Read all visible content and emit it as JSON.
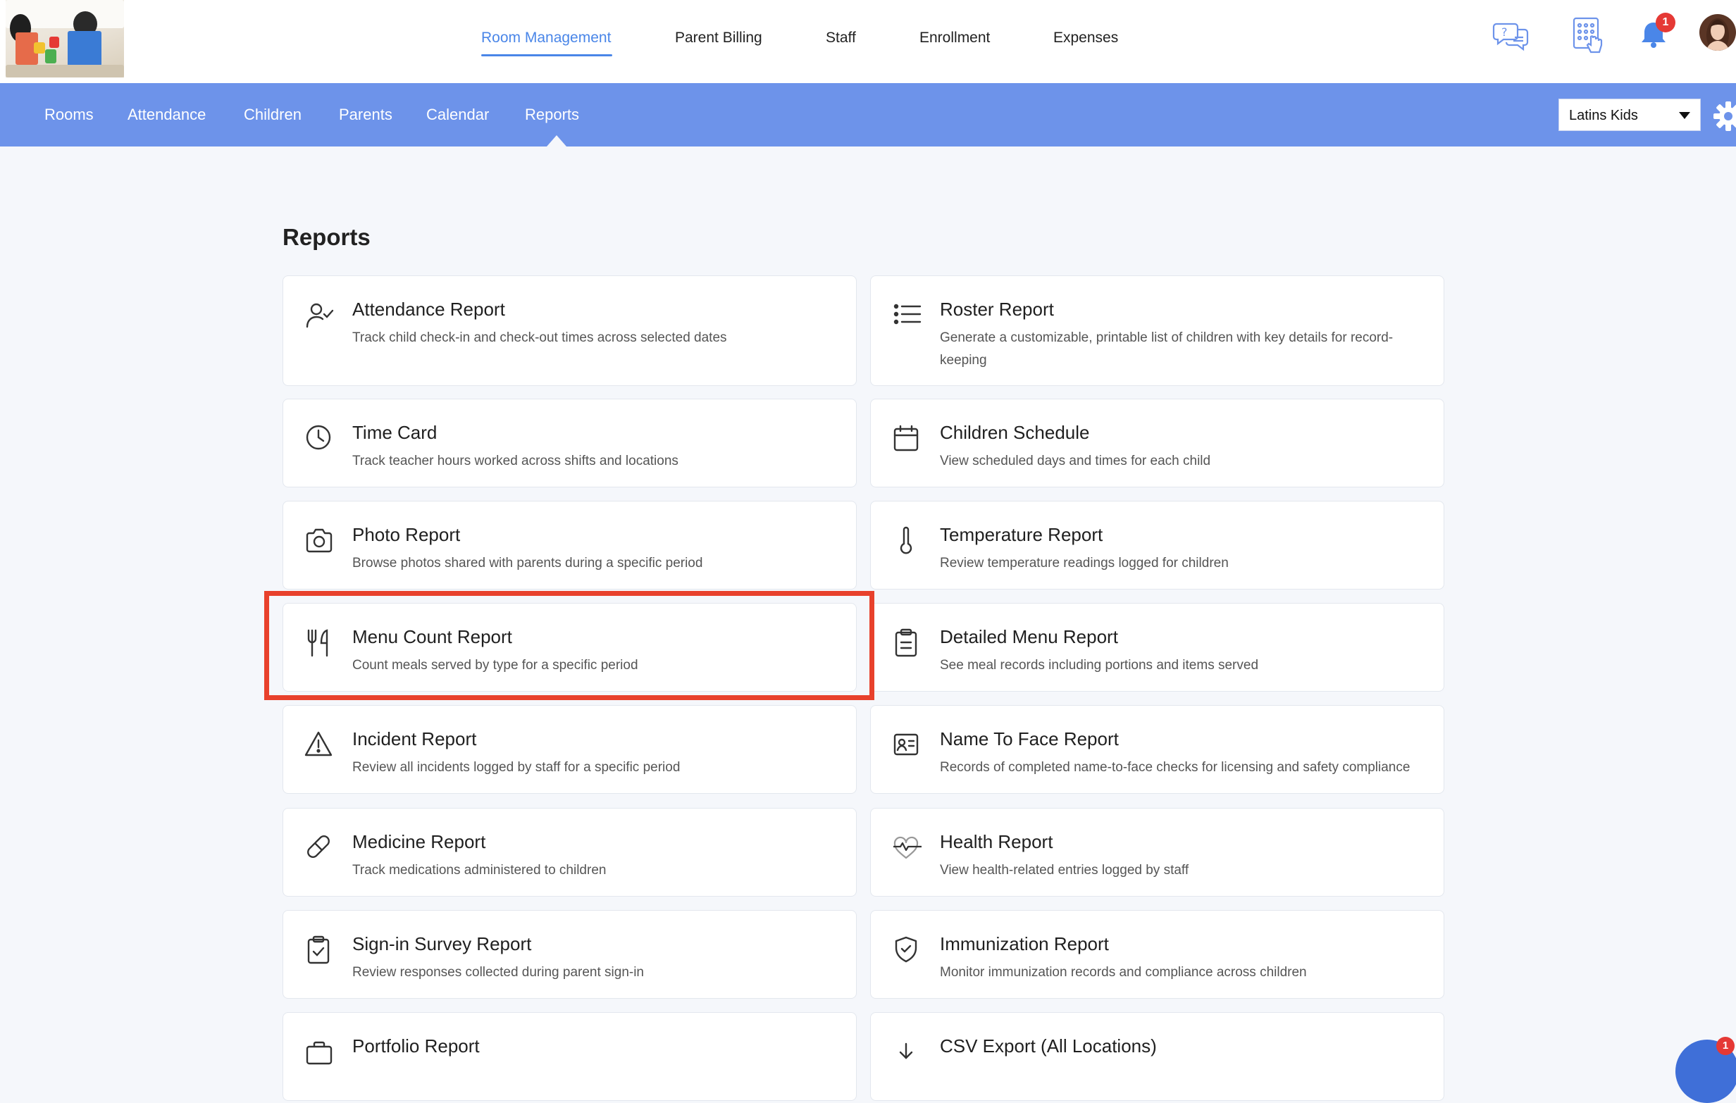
{
  "header": {
    "nav": [
      {
        "label": "Room Management",
        "active": true
      },
      {
        "label": "Parent Billing",
        "active": false
      },
      {
        "label": "Staff",
        "active": false
      },
      {
        "label": "Enrollment",
        "active": false
      },
      {
        "label": "Expenses",
        "active": false
      }
    ],
    "notification_count": "1",
    "icons": [
      "help-chat-icon",
      "kiosk-icon",
      "bell-icon",
      "avatar"
    ],
    "accent_color": "#4a86e8"
  },
  "subnav": {
    "items": [
      "Rooms",
      "Attendance",
      "Children",
      "Parents",
      "Calendar",
      "Reports"
    ],
    "active": "Reports",
    "location_select": "Latins Kids",
    "bar_color": "#6d93ea"
  },
  "main": {
    "title": "Reports",
    "reports": [
      {
        "title": "Attendance Report",
        "desc": "Track child check-in and check-out times across selected dates",
        "icon": "user-check-icon"
      },
      {
        "title": "Roster Report",
        "desc": "Generate a customizable, printable list of children with key details for record-keeping",
        "icon": "list-icon"
      },
      {
        "title": "Time Card",
        "desc": "Track teacher hours worked across shifts and locations",
        "icon": "clock-icon"
      },
      {
        "title": "Children Schedule",
        "desc": "View scheduled days and times for each child",
        "icon": "calendar-icon"
      },
      {
        "title": "Photo Report",
        "desc": "Browse photos shared with parents during a specific period",
        "icon": "camera-icon"
      },
      {
        "title": "Temperature Report",
        "desc": "Review temperature readings logged for children",
        "icon": "thermometer-icon"
      },
      {
        "title": "Menu Count Report",
        "desc": "Count meals served by type for a specific period",
        "icon": "utensils-icon",
        "highlighted": true
      },
      {
        "title": "Detailed Menu Report",
        "desc": "See meal records including portions and items served",
        "icon": "clipboard-icon"
      },
      {
        "title": "Incident Report",
        "desc": "Review all incidents logged by staff for a specific period",
        "icon": "warning-icon"
      },
      {
        "title": "Name To Face Report",
        "desc": "Records of completed name-to-face checks for licensing and safety compliance",
        "icon": "id-card-icon"
      },
      {
        "title": "Medicine Report",
        "desc": "Track medications administered to children",
        "icon": "pill-icon"
      },
      {
        "title": "Health Report",
        "desc": "View health-related entries logged by staff",
        "icon": "heart-pulse-icon"
      },
      {
        "title": "Sign-in Survey Report",
        "desc": "Review responses collected during parent sign-in",
        "icon": "clipboard-check-icon"
      },
      {
        "title": "Immunization Report",
        "desc": "Monitor immunization records and compliance across children",
        "icon": "shield-check-icon"
      },
      {
        "title": "Portfolio Report",
        "desc": "",
        "icon": "briefcase-icon"
      },
      {
        "title": "CSV Export (All Locations)",
        "desc": "",
        "icon": "download-icon"
      }
    ]
  },
  "chat_badge": "1",
  "highlight_color": "#e8412c"
}
